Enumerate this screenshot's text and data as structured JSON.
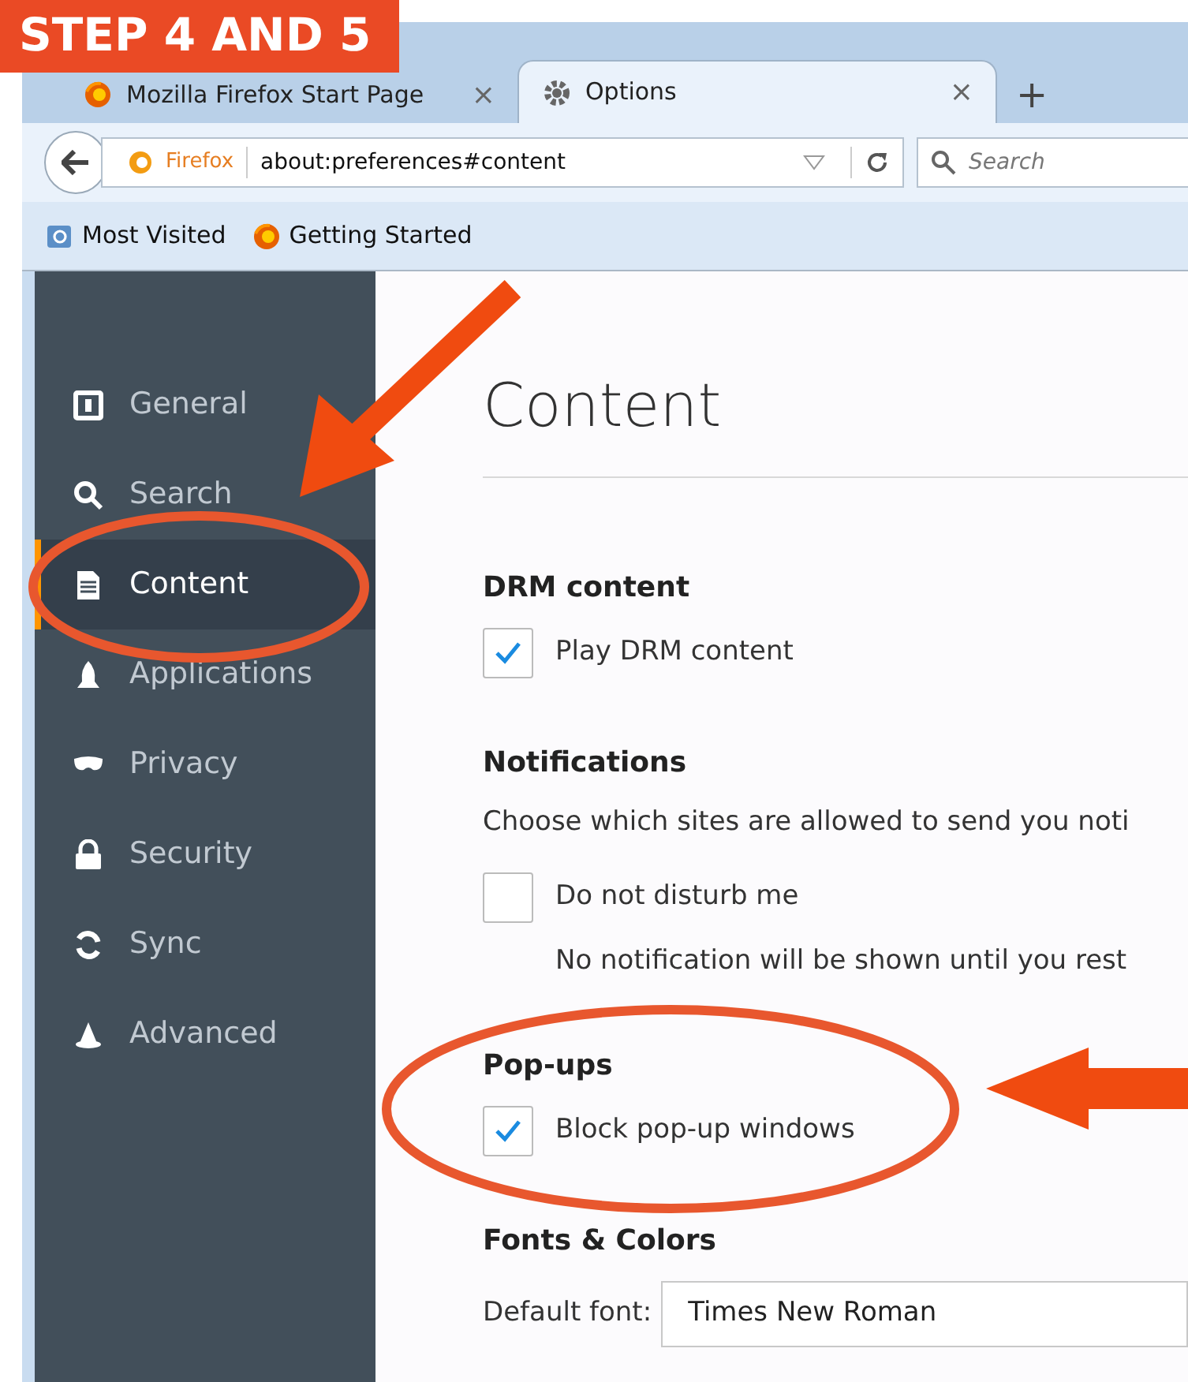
{
  "step_label": "STEP 4 AND 5",
  "tabs": [
    {
      "title": "Mozilla Firefox Start Page",
      "selected": false
    },
    {
      "title": "Options",
      "selected": true
    }
  ],
  "tab_close": "×",
  "new_tab": "+",
  "address_bar": {
    "identity": "Firefox",
    "url": "about:preferences#content"
  },
  "search": {
    "placeholder": "Search"
  },
  "bookmarks": [
    {
      "label": "Most Visited"
    },
    {
      "label": "Getting Started"
    }
  ],
  "sidebar": {
    "items": [
      {
        "label": "General",
        "selected": false
      },
      {
        "label": "Search",
        "selected": false
      },
      {
        "label": "Content",
        "selected": true
      },
      {
        "label": "Applications",
        "selected": false
      },
      {
        "label": "Privacy",
        "selected": false
      },
      {
        "label": "Security",
        "selected": false
      },
      {
        "label": "Sync",
        "selected": false
      },
      {
        "label": "Advanced",
        "selected": false
      }
    ]
  },
  "page_title": "Content",
  "sections": [
    {
      "heading": "DRM content",
      "items": [
        {
          "kind": "checkbox",
          "label": "Play DRM content",
          "checked": true
        }
      ]
    },
    {
      "heading": "Notifications",
      "items": [
        {
          "kind": "text",
          "label": "Choose which sites are allowed to send you noti"
        },
        {
          "kind": "checkbox",
          "label": "Do not disturb me",
          "checked": false
        },
        {
          "kind": "note",
          "label": "No notification will be shown until you rest"
        }
      ]
    },
    {
      "heading": "Pop-ups",
      "items": [
        {
          "kind": "checkbox",
          "label": "Block pop-up windows",
          "checked": true
        }
      ]
    },
    {
      "heading": "Fonts & Colors",
      "items": [
        {
          "kind": "select",
          "label": "Default font:",
          "value": "Times New Roman"
        }
      ]
    }
  ]
}
